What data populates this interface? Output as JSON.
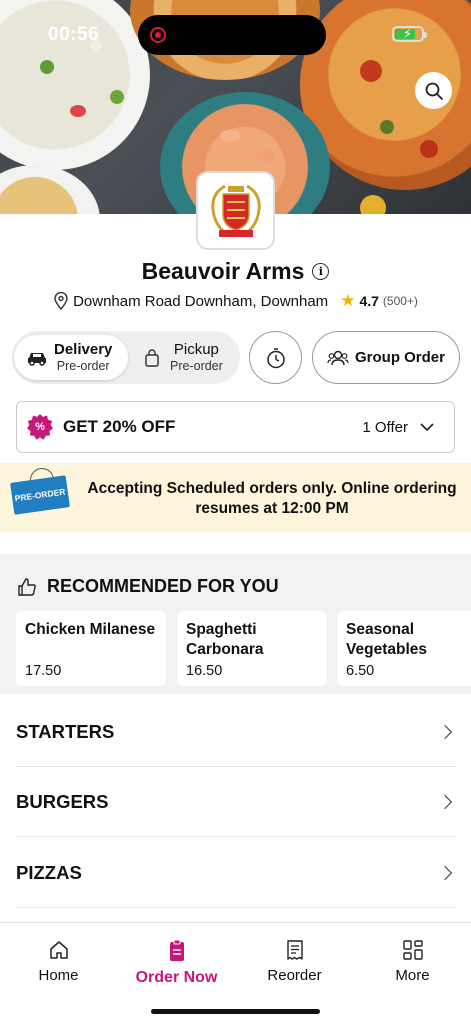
{
  "status_bar": {
    "time": "00:56"
  },
  "restaurant": {
    "name": "Beauvoir Arms",
    "address": "Downham Road Downham, Downham",
    "rating": "4.7",
    "rating_count": "(500+)"
  },
  "mode": {
    "delivery": {
      "label": "Delivery",
      "sub": "Pre-order"
    },
    "pickup": {
      "label": "Pickup",
      "sub": "Pre-order"
    }
  },
  "group_order_label": "Group Order",
  "offer": {
    "badge": "%",
    "title": "GET 20% OFF",
    "count": "1 Offer"
  },
  "banner": {
    "tag": "PRE-ORDER",
    "text": "Accepting Scheduled orders only. Online ordering resumes at 12:00 PM"
  },
  "recommended": {
    "heading": "RECOMMENDED FOR YOU",
    "items": [
      {
        "name": "Chicken Milanese",
        "price": "17.50"
      },
      {
        "name": "Spaghetti Carbonara",
        "price": "16.50"
      },
      {
        "name": "Seasonal Vegetables",
        "price": "6.50"
      }
    ]
  },
  "categories": [
    "STARTERS",
    "BURGERS",
    "PIZZAS"
  ],
  "tabs": [
    {
      "label": "Home",
      "icon": "home-icon"
    },
    {
      "label": "Order Now",
      "icon": "order-icon"
    },
    {
      "label": "Reorder",
      "icon": "receipt-icon"
    },
    {
      "label": "More",
      "icon": "grid-icon"
    }
  ],
  "colors": {
    "accent": "#c8177a",
    "banner_bg": "#fdf6dc",
    "star": "#f5b400"
  }
}
